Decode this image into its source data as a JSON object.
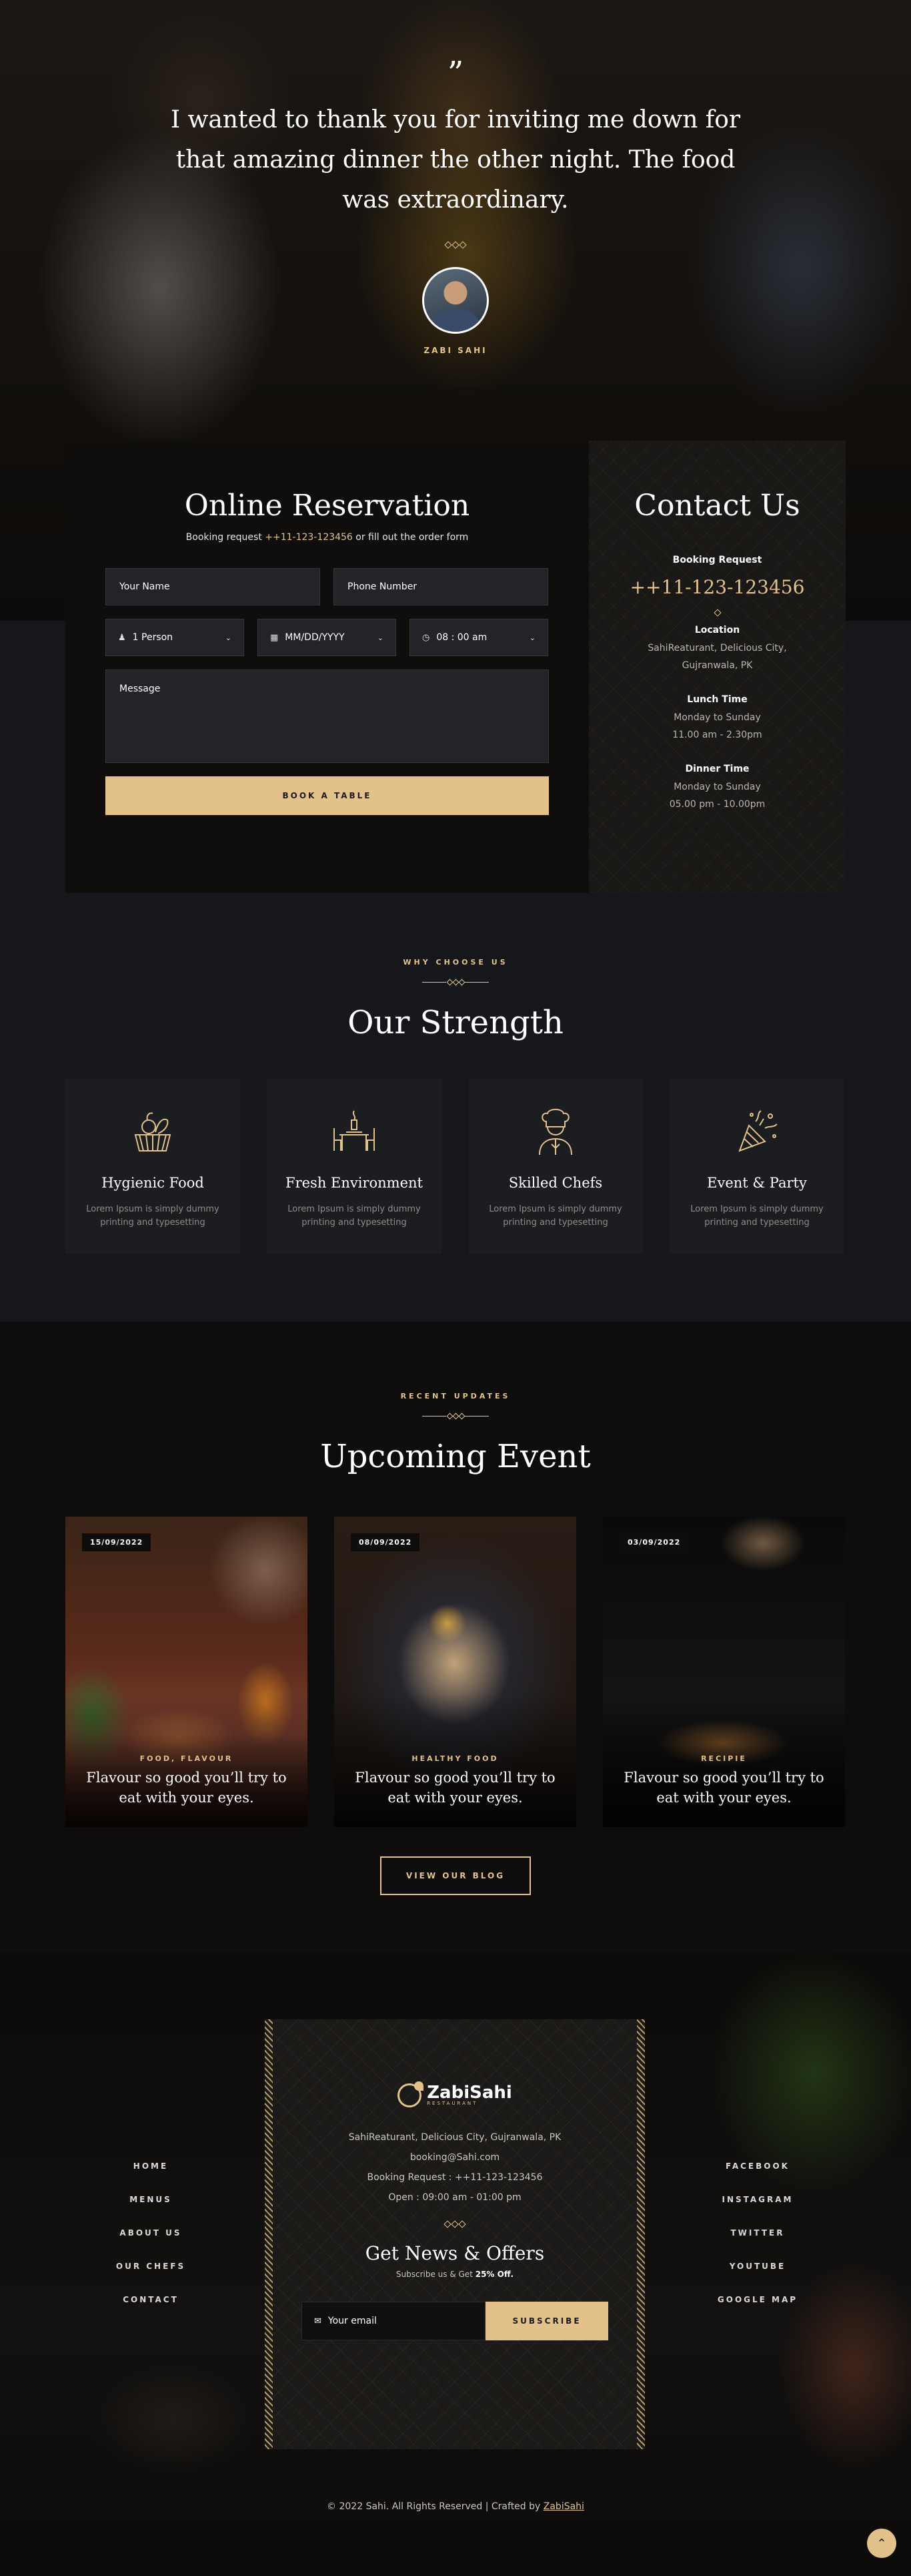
{
  "hero": {
    "quote_mark": "”",
    "quote": "I wanted to thank you for inviting me down for that amazing dinner the other night. The food was extraordinary.",
    "author": "ZABI SAHI"
  },
  "reservation": {
    "title": "Online Reservation",
    "subtitle_prefix": "Booking request ",
    "subtitle_phone": "++11-123-123456",
    "subtitle_suffix": " or fill out the order form",
    "name_placeholder": "Your Name",
    "phone_placeholder": "Phone Number",
    "persons_value": "1 Person",
    "date_value": "MM/DD/YYYY",
    "time_value": "08 : 00 am",
    "message_placeholder": "Message",
    "book_button": "BOOK A TABLE"
  },
  "contact": {
    "title": "Contact Us",
    "booking_label": "Booking Request",
    "booking_phone": "++11-123-123456",
    "location_label": "Location",
    "location_line1": "SahiReaturant, Delicious City,",
    "location_line2": "Gujranwala, PK",
    "lunch_label": "Lunch Time",
    "lunch_days": "Monday to Sunday",
    "lunch_hours": "11.00 am - 2.30pm",
    "dinner_label": "Dinner Time",
    "dinner_days": "Monday to Sunday",
    "dinner_hours": "05.00 pm - 10.00pm"
  },
  "strength": {
    "eyebrow": "WHY CHOOSE US",
    "title": "Our Strength",
    "cards": [
      {
        "title": "Hygienic Food",
        "desc": "Lorem Ipsum is simply dummy printing and typesetting",
        "icon": "vegetable-basket-icon"
      },
      {
        "title": "Fresh Environment",
        "desc": "Lorem Ipsum is simply dummy printing and typesetting",
        "icon": "dining-table-icon"
      },
      {
        "title": "Skilled Chefs",
        "desc": "Lorem Ipsum is simply dummy printing and typesetting",
        "icon": "chef-icon"
      },
      {
        "title": "Event & Party",
        "desc": "Lorem Ipsum is simply dummy printing and typesetting",
        "icon": "party-popper-icon"
      }
    ]
  },
  "events": {
    "eyebrow": "RECENT UPDATES",
    "title": "Upcoming Event",
    "items": [
      {
        "date": "15/09/2022",
        "category": "FOOD, FLAVOUR",
        "title": "Flavour so good you’ll try to eat with your eyes."
      },
      {
        "date": "08/09/2022",
        "category": "HEALTHY FOOD",
        "title": "Flavour so good you’ll try to eat with your eyes."
      },
      {
        "date": "03/09/2022",
        "category": "RECIPIE",
        "title": "Flavour so good you’ll try to eat with your eyes."
      }
    ],
    "blog_button": "VIEW OUR BLOG"
  },
  "footer": {
    "logo_name": "ZabiSahi",
    "logo_sub": "RESTAURANT",
    "address": "SahiReaturant, Delicious City, Gujranwala, PK",
    "email": "booking@Sahi.com",
    "booking": "Booking Request : ++11-123-123456",
    "open": "Open : 09:00 am - 01:00 pm",
    "news_title": "Get News & Offers",
    "news_sub_prefix": "Subscribe us & Get ",
    "news_sub_bold": "25% Off.",
    "email_placeholder": "Your email",
    "subscribe_button": "SUBSCRIBE",
    "left_nav": [
      "HOME",
      "MENUS",
      "ABOUT US",
      "OUR CHEFS",
      "CONTACT"
    ],
    "right_nav": [
      "FACEBOOK",
      "INSTAGRAM",
      "TWITTER",
      "YOUTUBE",
      "GOOGLE MAP"
    ],
    "copyright_prefix": "© 2022 Sahi. All Rights Reserved | Crafted by ",
    "copyright_link": "ZabiSahi"
  },
  "colors": {
    "accent": "#e2c28a",
    "dark": "#0e0d0c",
    "panel": "#16171a"
  }
}
